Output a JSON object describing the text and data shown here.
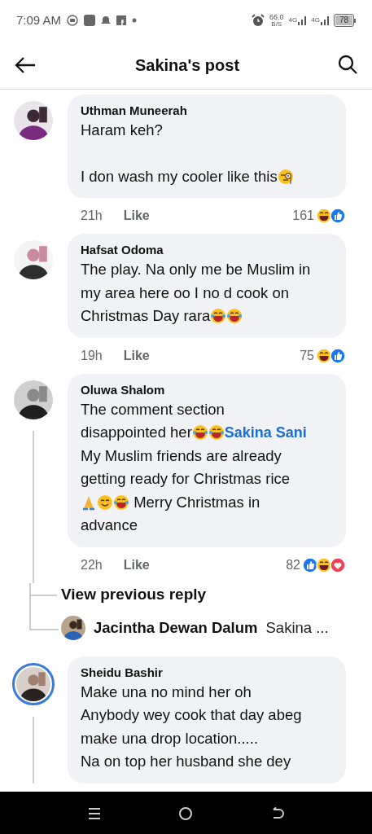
{
  "status_bar": {
    "time": "7:09 AM",
    "speed": "66.0",
    "speed_unit": "B/S",
    "network_1": "4G",
    "network_2": "4G",
    "battery": "78"
  },
  "header": {
    "title": "Sakina's post"
  },
  "comments": [
    {
      "author": "Uthman Muneerah",
      "avatar_ring": false,
      "paragraphs": [
        [
          [
            {
              "kind": "text",
              "text": "Haram keh?"
            }
          ]
        ],
        [
          [
            {
              "kind": "text",
              "text": "I don wash my cooler like this"
            },
            {
              "kind": "monocle"
            }
          ]
        ]
      ],
      "time": "21h",
      "like": "Like",
      "reaction_count": "161",
      "reactions": [
        {
          "kind": "haha"
        },
        {
          "kind": "like"
        }
      ]
    },
    {
      "author": "Hafsat Odoma",
      "avatar_ring": false,
      "paragraphs": [
        [
          [
            {
              "kind": "text",
              "text": "The play. Na only me be Muslim in"
            }
          ],
          [
            {
              "kind": "text",
              "text": "my area here oo I no d cook on"
            }
          ],
          [
            {
              "kind": "text",
              "text": "Christmas Day rara"
            },
            {
              "kind": "laugh"
            },
            {
              "kind": "laugh"
            }
          ]
        ]
      ],
      "time": "19h",
      "like": "Like",
      "reaction_count": "75",
      "reactions": [
        {
          "kind": "haha"
        },
        {
          "kind": "like"
        }
      ]
    },
    {
      "author": "Oluwa Shalom",
      "avatar_ring": false,
      "paragraphs": [
        [
          [
            {
              "kind": "text",
              "text": "The comment section"
            }
          ],
          [
            {
              "kind": "text",
              "text": "disappointed her"
            },
            {
              "kind": "laugh"
            },
            {
              "kind": "laugh"
            },
            {
              "kind": "mention",
              "text": "Sakina Sani"
            }
          ],
          [
            {
              "kind": "text",
              "text": "My Muslim friends are already"
            }
          ],
          [
            {
              "kind": "text",
              "text": "getting ready for Christmas rice"
            }
          ],
          [
            {
              "kind": "pray"
            },
            {
              "kind": "smile"
            },
            {
              "kind": "laugh"
            },
            {
              "kind": "text",
              "text": " Merry Christmas in"
            }
          ],
          [
            {
              "kind": "text",
              "text": "advance"
            }
          ]
        ]
      ],
      "time": "22h",
      "like": "Like",
      "reaction_count": "82",
      "reactions": [
        {
          "kind": "like"
        },
        {
          "kind": "haha"
        },
        {
          "kind": "love"
        }
      ],
      "replies": {
        "view_previous": "View previous reply",
        "reply": {
          "author": "Jacintha Dewan Dalum",
          "snippet": "Sakina ..."
        }
      }
    },
    {
      "author": "Sheidu Bashir",
      "avatar_ring": true,
      "paragraphs": [
        [
          [
            {
              "kind": "text",
              "text": "Make una no mind her oh"
            }
          ],
          [
            {
              "kind": "text",
              "text": "Anybody wey cook that day abeg"
            }
          ],
          [
            {
              "kind": "text",
              "text": "make una drop location....."
            }
          ],
          [
            {
              "kind": "text",
              "text": "Na on top her husband she dey"
            }
          ]
        ]
      ]
    }
  ]
}
